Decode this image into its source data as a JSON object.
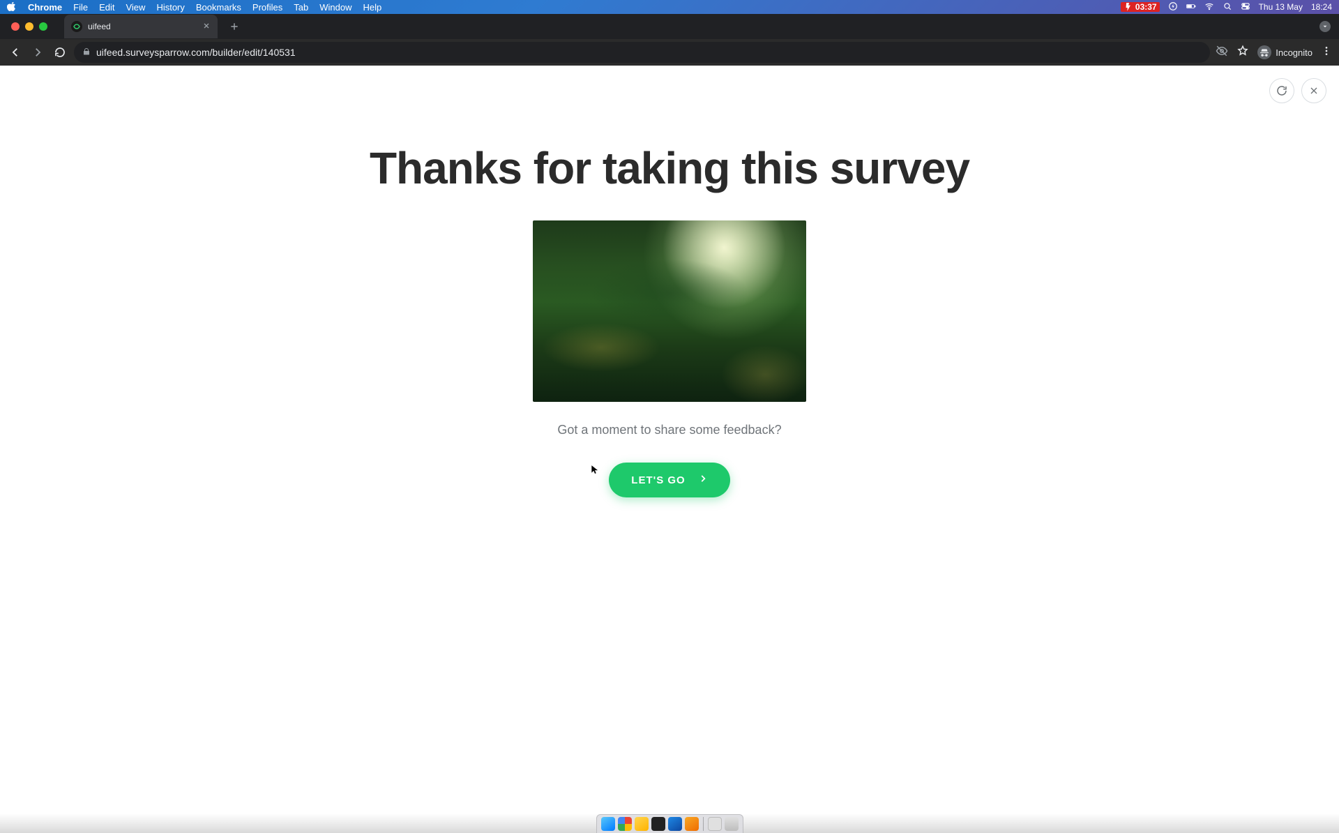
{
  "menubar": {
    "app": "Chrome",
    "items": [
      "File",
      "Edit",
      "View",
      "History",
      "Bookmarks",
      "Profiles",
      "Tab",
      "Window",
      "Help"
    ],
    "battery_time": "03:37",
    "date": "Thu 13 May",
    "time": "18:24"
  },
  "chrome": {
    "tab_title": "uifeed",
    "url": "uifeed.surveysparrow.com/builder/edit/140531",
    "incognito_label": "Incognito"
  },
  "survey": {
    "heading": "Thanks for taking this survey",
    "subtext": "Got a moment to share some feedback?",
    "cta_label": "LET'S GO",
    "image_alt": "forest canopy with sunlight"
  }
}
